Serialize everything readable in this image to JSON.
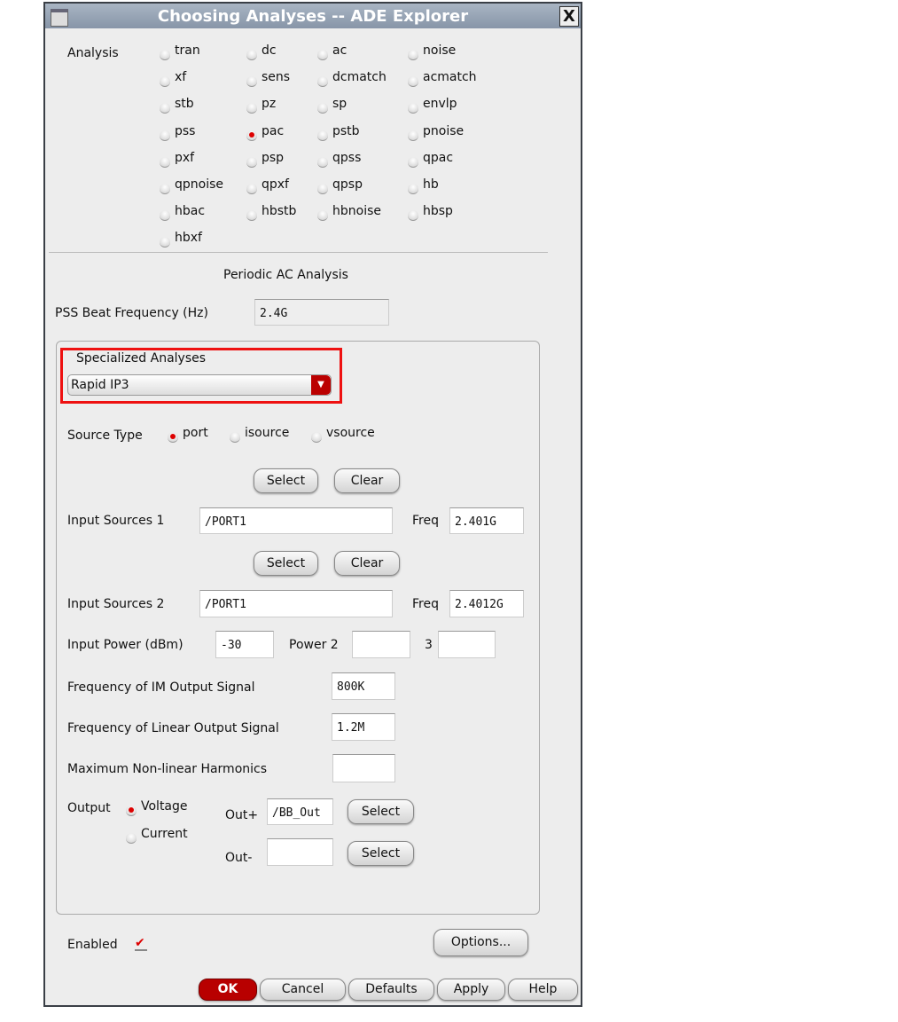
{
  "window": {
    "title": "Choosing Analyses -- ADE Explorer",
    "close": "X"
  },
  "analysis": {
    "label": "Analysis",
    "options": [
      "tran",
      "dc",
      "ac",
      "noise",
      "xf",
      "sens",
      "dcmatch",
      "acmatch",
      "stb",
      "pz",
      "sp",
      "envlp",
      "pss",
      "pac",
      "pstb",
      "pnoise",
      "pxf",
      "psp",
      "qpss",
      "qpac",
      "qpnoise",
      "qpxf",
      "qpsp",
      "hb",
      "hbac",
      "hbstb",
      "hbnoise",
      "hbsp",
      "hbxf"
    ],
    "selected": "pac"
  },
  "section_title": "Periodic AC Analysis",
  "pss": {
    "label": "PSS Beat Frequency (Hz)",
    "value": "2.4G"
  },
  "specialized": {
    "label": "Specialized Analyses",
    "value": "Rapid IP3",
    "arrow": "▼"
  },
  "source_type": {
    "label": "Source Type",
    "options": [
      "port",
      "isource",
      "vsource"
    ],
    "selected": "port"
  },
  "buttons": {
    "select": "Select",
    "clear": "Clear",
    "options": "Options...",
    "ok": "OK",
    "cancel": "Cancel",
    "defaults": "Defaults",
    "apply": "Apply",
    "help": "Help"
  },
  "input1": {
    "label": "Input Sources 1",
    "value": "/PORT1",
    "freq_label": "Freq",
    "freq": "2.401G"
  },
  "input2": {
    "label": "Input Sources 2",
    "value": "/PORT1",
    "freq_label": "Freq",
    "freq": "2.4012G"
  },
  "power": {
    "label": "Input Power (dBm)",
    "value": "-30",
    "power2_label": "Power 2",
    "power2": "",
    "power3_label": "3",
    "power3": ""
  },
  "im_freq": {
    "label": "Frequency of IM Output Signal",
    "value": "800K"
  },
  "lin_freq": {
    "label": "Frequency of Linear Output Signal",
    "value": "1.2M"
  },
  "max_harm": {
    "label": "Maximum Non-linear Harmonics",
    "value": ""
  },
  "output": {
    "label": "Output",
    "options": [
      "Voltage",
      "Current"
    ],
    "selected": "Voltage",
    "outp_label": "Out+",
    "outp": "/BB_Out",
    "outm_label": "Out-",
    "outm": ""
  },
  "enabled": {
    "label": "Enabled",
    "checked": true,
    "mark": "✔"
  }
}
